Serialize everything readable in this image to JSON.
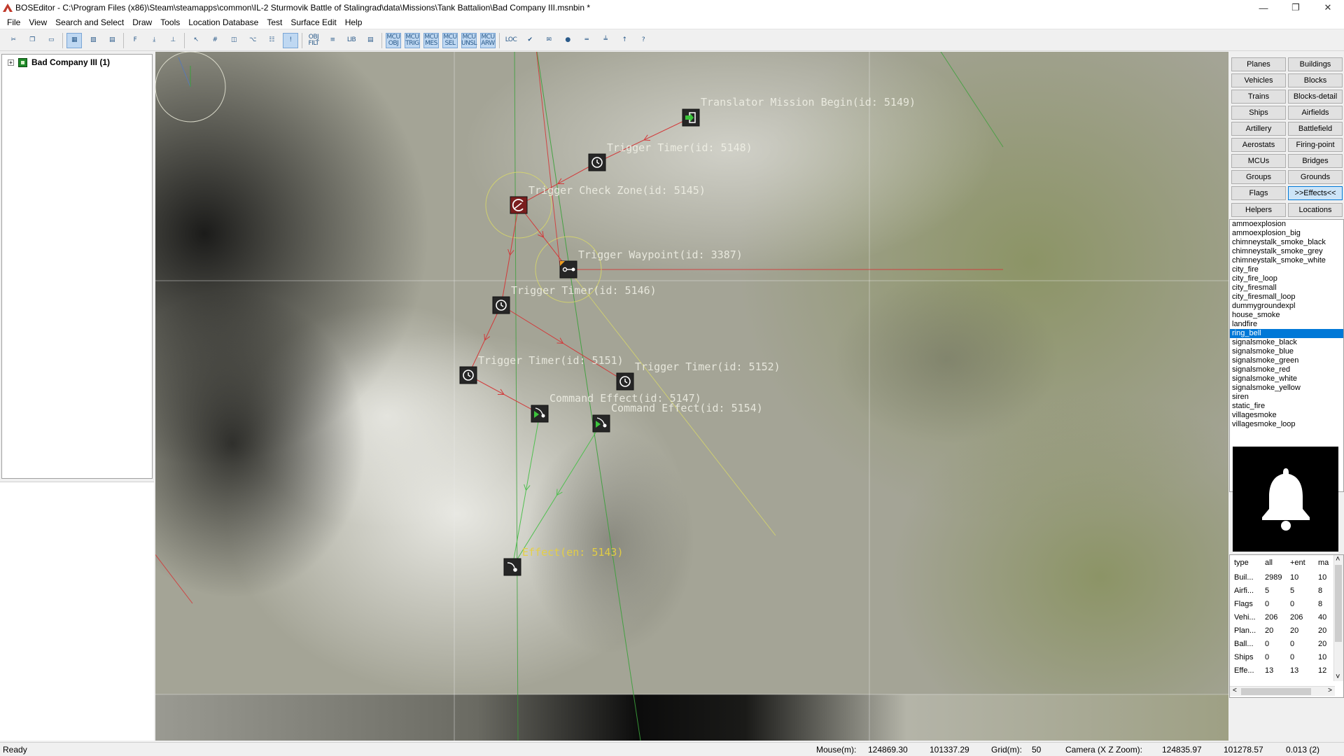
{
  "window": {
    "title": "BOSEditor - C:\\Program Files (x86)\\Steam\\steamapps\\common\\IL-2 Sturmovik Battle of Stalingrad\\data\\Missions\\Tank Battalion\\Bad Company III.msnbin *",
    "min_glyph": "—",
    "max_glyph": "❐",
    "close_glyph": "✕"
  },
  "menu": [
    "File",
    "View",
    "Search and Select",
    "Draw",
    "Tools",
    "Location Database",
    "Test",
    "Surface Edit",
    "Help"
  ],
  "toolbar": {
    "groups": [
      [
        {
          "label": "✂",
          "icon": "cut-icon"
        },
        {
          "label": "❐",
          "icon": "copy-icon"
        },
        {
          "label": "▭",
          "icon": "paste-icon"
        }
      ],
      [
        {
          "label": "▦",
          "icon": "map-icon",
          "active": true
        },
        {
          "label": "▧",
          "icon": "map-alt-icon"
        },
        {
          "label": "▤",
          "icon": "layers-icon"
        }
      ],
      [
        {
          "label": "F",
          "icon": "font-icon"
        },
        {
          "label": "⤓",
          "icon": "download-icon"
        },
        {
          "label": "⊥",
          "icon": "ground-icon"
        }
      ],
      [
        {
          "label": "↖",
          "icon": "select-arrow-icon"
        },
        {
          "label": "#",
          "icon": "grid-icon"
        },
        {
          "label": "◫",
          "icon": "split-icon"
        },
        {
          "label": "⌥",
          "icon": "tool-icon"
        },
        {
          "label": "☷",
          "icon": "filter-icon"
        },
        {
          "label": "!",
          "icon": "info-icon",
          "active": true
        }
      ],
      [
        {
          "label": "OBJ FILT",
          "icon": "object-filter-icon"
        },
        {
          "label": "≡",
          "icon": "list-icon"
        },
        {
          "label": "LIB",
          "icon": "library-icon"
        },
        {
          "label": "▤",
          "icon": "properties-icon"
        }
      ],
      [
        {
          "label": "MCU OBJ",
          "icon": "mcu-obj-icon",
          "active": true
        },
        {
          "label": "MCU TRIG",
          "icon": "mcu-trig-icon",
          "active": true
        },
        {
          "label": "MCU MES",
          "icon": "mcu-mes-icon",
          "active": true
        },
        {
          "label": "MCU SEL",
          "icon": "mcu-sel-icon",
          "active": true
        },
        {
          "label": "MCU UNSL",
          "icon": "mcu-unsel-icon",
          "active": true
        },
        {
          "label": "MCU ARW",
          "icon": "mcu-arrow-icon",
          "active": true
        }
      ],
      [
        {
          "label": "LOC",
          "icon": "loc-icon"
        },
        {
          "label": "✔",
          "icon": "check-icon"
        },
        {
          "label": "✉",
          "icon": "message-icon"
        },
        {
          "label": "●",
          "icon": "green-dot-icon"
        },
        {
          "label": "═",
          "icon": "bridge-icon"
        },
        {
          "label": "╧",
          "icon": "terrain-icon"
        },
        {
          "label": "↑",
          "icon": "up-arrow-icon"
        },
        {
          "label": "?",
          "icon": "help-icon"
        }
      ]
    ]
  },
  "tree": {
    "root_label": "Bad Company III (1)",
    "expander": "+"
  },
  "viewport": {
    "nodes": [
      {
        "label": "Translator Mission Begin(id: 5149)",
        "icon": "mission-begin-icon"
      },
      {
        "label": "Trigger Timer(id: 5148)",
        "icon": "timer-icon"
      },
      {
        "label": "Trigger Check Zone(id: 5145)",
        "icon": "check-zone-icon"
      },
      {
        "label": "Trigger Waypoint(id: 3387)",
        "icon": "waypoint-icon"
      },
      {
        "label": "Trigger Timer(id: 5146)",
        "icon": "timer-icon"
      },
      {
        "label": "Trigger Timer(id: 5151)",
        "icon": "timer-icon"
      },
      {
        "label": "Trigger Timer(id: 5152)",
        "icon": "timer-icon"
      },
      {
        "label": "Command Effect(id: 5147)",
        "icon": "command-effect-icon"
      },
      {
        "label": "Command Effect(id: 5154)",
        "icon": "command-effect-icon"
      },
      {
        "label": "Effect(en: 5143)",
        "icon": "effect-icon"
      }
    ],
    "colors": {
      "link": "#d23a3a",
      "target": "#4fbf4f",
      "zone": "#d8d86a",
      "effect_label": "#e6d040"
    }
  },
  "categories": [
    [
      "Planes",
      "Buildings"
    ],
    [
      "Vehicles",
      "Blocks"
    ],
    [
      "Trains",
      "Blocks-detail"
    ],
    [
      "Ships",
      "Airfields"
    ],
    [
      "Artillery",
      "Battlefield"
    ],
    [
      "Aerostats",
      "Firing-point"
    ],
    [
      "MCUs",
      "Bridges"
    ],
    [
      "Groups",
      "Grounds"
    ],
    [
      "Flags",
      ">>Effects<<"
    ],
    [
      "Helpers",
      "Locations"
    ]
  ],
  "effects": [
    "ammoexplosion",
    "ammoexplosion_big",
    "chimneystalk_smoke_black",
    "chimneystalk_smoke_grey",
    "chimneystalk_smoke_white",
    "city_fire",
    "city_fire_loop",
    "city_firesmall",
    "city_firesmall_loop",
    "dummygroundexpl",
    "house_smoke",
    "landfire",
    "ring_bell",
    "signalsmoke_black",
    "signalsmoke_blue",
    "signalsmoke_green",
    "signalsmoke_red",
    "signalsmoke_white",
    "signalsmoke_yellow",
    "siren",
    "static_fire",
    "villagesmoke",
    "villagesmoke_loop"
  ],
  "selected_effect": "ring_bell",
  "stats": {
    "headers": [
      "type",
      "all",
      "+ent",
      "ma"
    ],
    "rows": [
      [
        "Buil...",
        "2989",
        "10",
        "10"
      ],
      [
        "Airfi...",
        "5",
        "5",
        "8"
      ],
      [
        "Flags",
        "0",
        "0",
        "8"
      ],
      [
        "Vehi...",
        "206",
        "206",
        "40"
      ],
      [
        "Plan...",
        "20",
        "20",
        "20"
      ],
      [
        "Ball...",
        "0",
        "0",
        "20"
      ],
      [
        "Ships",
        "0",
        "0",
        "10"
      ],
      [
        "Effe...",
        "13",
        "13",
        "12"
      ]
    ],
    "scroll_up": "˄",
    "scroll_down": "˅",
    "scroll_left": "<",
    "scroll_right": ">"
  },
  "status": {
    "ready": "Ready",
    "mouse_label": "Mouse(m):",
    "mouse_x": "124869.30",
    "mouse_z": "101337.29",
    "grid_label": "Grid(m):",
    "grid_value": "50",
    "camera_label": "Camera (X Z Zoom):",
    "camera_x": "124835.97",
    "camera_z": "101278.57",
    "camera_zoom": "0.013 (2)"
  }
}
